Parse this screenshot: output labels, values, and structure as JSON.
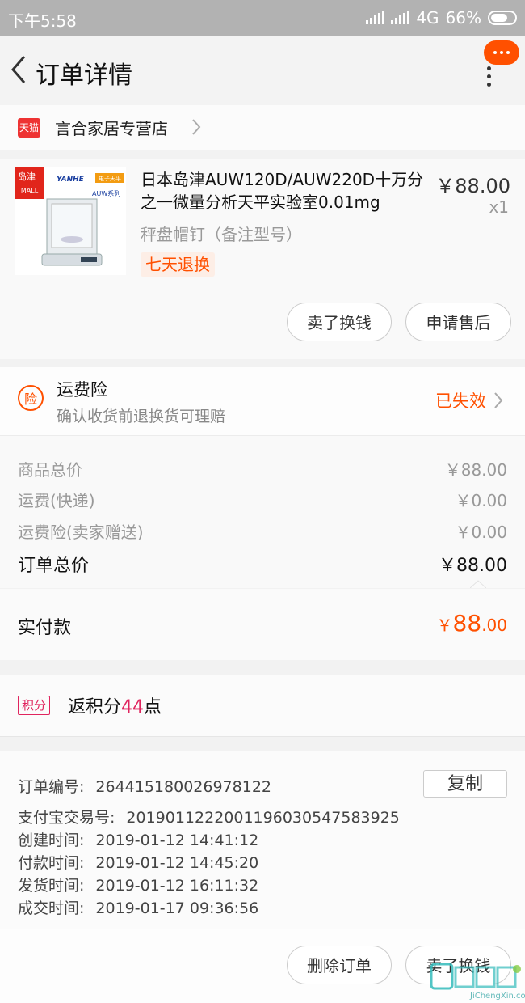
{
  "status_bar": {
    "time": "下午5:58",
    "network": "4G",
    "battery": "66%"
  },
  "nav": {
    "title": "订单详情"
  },
  "shop": {
    "tmall_label": "天猫",
    "name": "言合家居专营店"
  },
  "product": {
    "image_text_brand": "岛津",
    "image_text_tmall": "TMALL",
    "image_text_yanhe": "YANHE",
    "image_text_series": "AUW系列",
    "image_text_promo": "电子天平",
    "title": "日本岛津AUW120D/AUW220D十万分之一微量分析天平实验室0.01mg",
    "price": "￥88.00",
    "quantity": "x1",
    "spec": "秤盘帽钉（备注型号）",
    "tag": "七天退换",
    "buttons": {
      "sell": "卖了换钱",
      "after_sale": "申请售后"
    }
  },
  "insurance": {
    "icon_label": "险",
    "title": "运费险",
    "desc": "确认收货前退换货可理赔",
    "status": "已失效"
  },
  "totals": {
    "rows": [
      {
        "label": "商品总价",
        "value": "￥88.00"
      },
      {
        "label": "运费(快递)",
        "value": "￥0.00"
      },
      {
        "label": "运费险(卖家赠送)",
        "value": "￥0.00"
      }
    ],
    "order_total_label": "订单总价",
    "order_total_value": "￥88.00"
  },
  "payment": {
    "label": "实付款",
    "currency": "￥",
    "integer": "88",
    "decimal": ".00"
  },
  "points": {
    "badge": "积分",
    "prefix": "返积分",
    "number": "44",
    "suffix": "点"
  },
  "order_info": {
    "copy_button": "复制",
    "lines": [
      {
        "label": "订单编号:",
        "value": "264415180026978122"
      },
      {
        "label": "支付宝交易号:",
        "value": "2019011222001196030547583925"
      },
      {
        "label": "创建时间:",
        "value": "2019-01-12 14:41:12"
      },
      {
        "label": "付款时间:",
        "value": "2019-01-12 14:45:20"
      },
      {
        "label": "发货时间:",
        "value": "2019-01-12 16:11:32"
      },
      {
        "label": "成交时间:",
        "value": "2019-01-17 09:36:56"
      }
    ]
  },
  "bottom_bar": {
    "delete": "删除订单",
    "sell": "卖了换钱"
  },
  "watermark": {
    "text": "JiChengXin.com"
  },
  "colors": {
    "accent": "#ff5000",
    "points": "#e0245e",
    "statusbar": "#b2b2b2"
  }
}
